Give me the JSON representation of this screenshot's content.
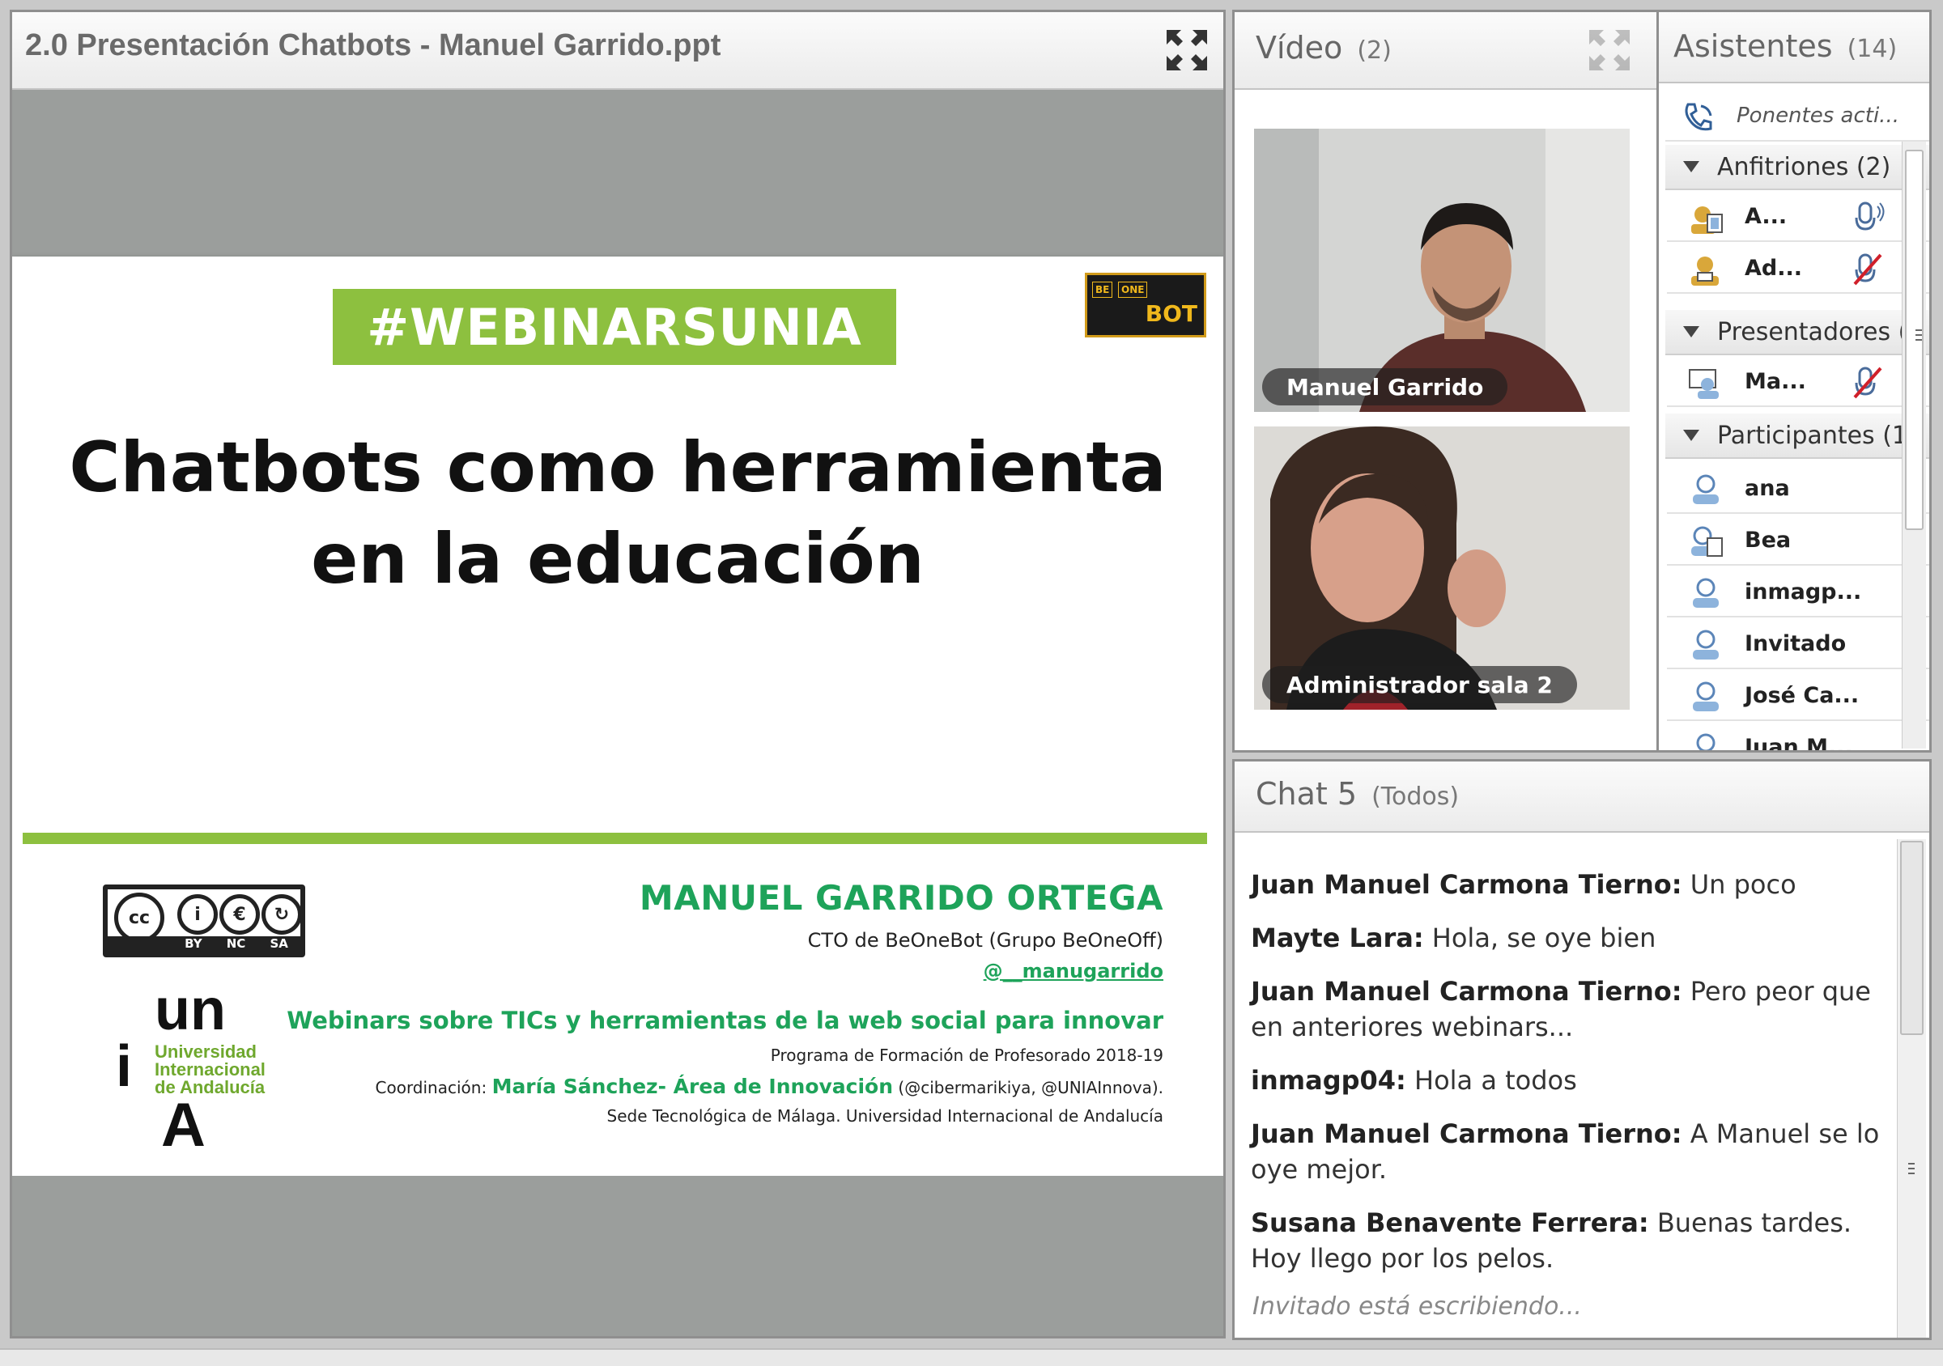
{
  "share": {
    "title": "2.0 Presentación Chatbots - Manuel Garrido.ppt",
    "slide": {
      "tag": "#WEBINARSUNIA",
      "logo_small_1": "BE",
      "logo_small_2": "ONE",
      "logo_big": "BOT",
      "title_line1": "Chatbots como herramienta",
      "title_line2": "en la educación",
      "cc": {
        "cc": "cc",
        "by": "BY",
        "nc": "NC",
        "sa": "SA"
      },
      "unia": {
        "un": "un",
        "i": "i",
        "line1": "Universidad",
        "line2": "Internacional",
        "line3": "de Andalucía",
        "a": "A"
      },
      "author": "MANUEL GARRIDO ORTEGA",
      "role": "CTO de BeOneBot (Grupo BeOneOff)",
      "handle": "@__manugarrido",
      "webinars": "Webinars sobre TICs y herramientas de la web social para innovar",
      "programa": "Programa de Formación de Profesorado 2018-19",
      "coord_label": "Coordinación: ",
      "coord_name": "María Sánchez- Área de Innovación",
      "coord_handles": " (@cibermarikiya, @UNIAInnova).",
      "sede": "Sede Tecnológica de Málaga. Universidad Internacional de Andalucía"
    }
  },
  "video": {
    "title": "Vídeo",
    "count": "(2)",
    "feeds": [
      {
        "name": "Manuel Garrido"
      },
      {
        "name": "Administrador sala 2"
      }
    ]
  },
  "attendees": {
    "title": "Asistentes",
    "count": "(14)",
    "active_speakers": "Ponentes acti...",
    "groups": {
      "hosts": "Anfitriones (2)",
      "presenters": "Presentadores (",
      "participants": "Participantes (1"
    },
    "hosts": [
      "A...",
      "Ad..."
    ],
    "presenters": [
      "Ma..."
    ],
    "participants": [
      "ana",
      "Bea",
      "inmagp...",
      "Invitado",
      "José Ca...",
      "Juan M..."
    ]
  },
  "chat": {
    "title": "Chat 5",
    "scope": "(Todos)",
    "messages": [
      {
        "sender": "Juan Manuel Carmona Tierno:",
        "text": " Un poco"
      },
      {
        "sender": "Mayte Lara:",
        "text": " Hola, se oye bien"
      },
      {
        "sender": "Juan Manuel Carmona Tierno:",
        "text": " Pero peor que en anteriores webinars..."
      },
      {
        "sender": "inmagp04:",
        "text": " Hola a todos"
      },
      {
        "sender": "Juan Manuel Carmona Tierno:",
        "text": " A Manuel se lo oye mejor."
      },
      {
        "sender": "Susana Benavente Ferrera:",
        "text": " Buenas tardes. Hoy llego por los pelos."
      }
    ],
    "typing": "Invitado está escribiendo..."
  },
  "colors": {
    "accent_green": "#8dc03f",
    "text_green": "#1ea35a",
    "mute_red": "#d0202a"
  }
}
